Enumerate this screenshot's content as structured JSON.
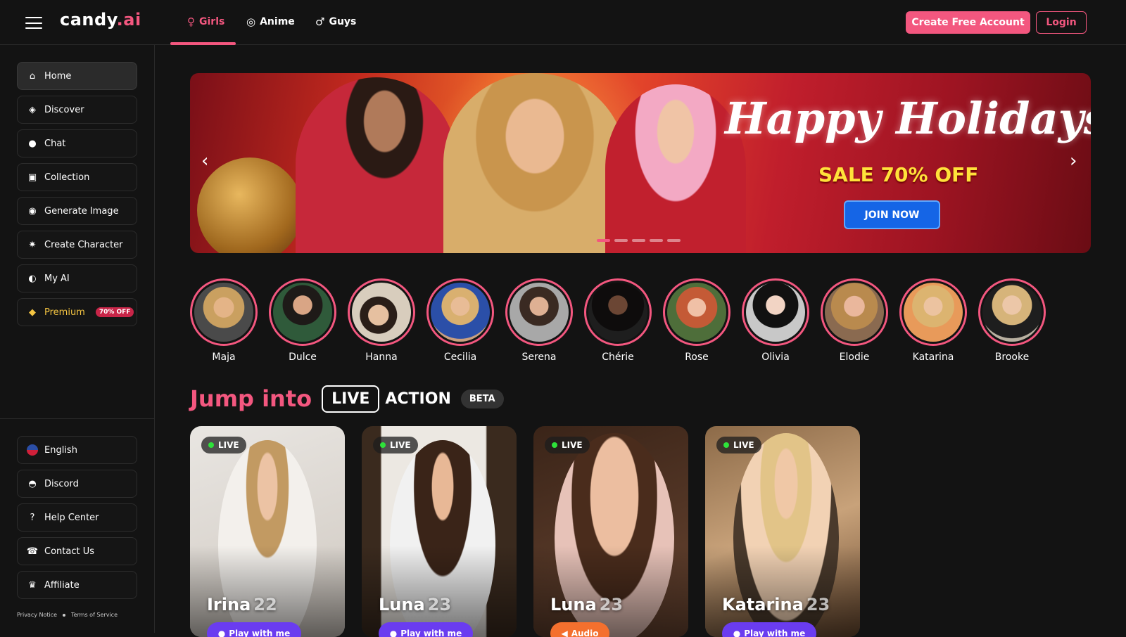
{
  "header": {
    "logo_main": "candy",
    "logo_accent": ".ai",
    "tabs": [
      {
        "label": "Girls",
        "icon": "female-icon"
      },
      {
        "label": "Anime",
        "icon": "anime-icon"
      },
      {
        "label": "Guys",
        "icon": "male-icon"
      }
    ],
    "create_account_label": "Create Free Account",
    "login_label": "Login"
  },
  "sidebar": {
    "items": [
      {
        "label": "Home",
        "icon": "home-icon"
      },
      {
        "label": "Discover",
        "icon": "compass-icon"
      },
      {
        "label": "Chat",
        "icon": "chat-icon"
      },
      {
        "label": "Collection",
        "icon": "image-icon"
      },
      {
        "label": "Generate Image",
        "icon": "camera-icon"
      },
      {
        "label": "Create Character",
        "icon": "magic-wand-icon"
      },
      {
        "label": "My AI",
        "icon": "mask-icon"
      },
      {
        "label": "Premium",
        "icon": "diamond-icon",
        "badge": "70% OFF"
      }
    ],
    "bottom_items": [
      {
        "label": "English",
        "icon": "us-flag-icon"
      },
      {
        "label": "Discord",
        "icon": "discord-icon"
      },
      {
        "label": "Help Center",
        "icon": "help-icon"
      },
      {
        "label": "Contact Us",
        "icon": "phone-icon"
      },
      {
        "label": "Affiliate",
        "icon": "trophy-icon"
      }
    ],
    "legal": {
      "privacy": "Privacy Notice",
      "terms": "Terms of Service"
    }
  },
  "banner": {
    "title": "Happy Holidays",
    "sale": "SALE 70% OFF",
    "cta": "JOIN NOW",
    "slide_count": 5,
    "active_slide": 1
  },
  "stories": [
    "Maja",
    "Dulce",
    "Hanna",
    "Cecilia",
    "Serena",
    "Chérie",
    "Rose",
    "Olivia",
    "Elodie",
    "Katarina",
    "Brooke"
  ],
  "jump": {
    "prefix": "Jump into",
    "live": "LIVE",
    "action": "ACTION",
    "beta": "BETA"
  },
  "cards": [
    {
      "name": "Irina",
      "age": "22",
      "badge": "LIVE",
      "button": "Play with me",
      "button_type": "play"
    },
    {
      "name": "Luna",
      "age": "23",
      "badge": "LIVE",
      "button": "Play with me",
      "button_type": "play"
    },
    {
      "name": "Luna",
      "age": "23",
      "badge": "LIVE",
      "button": "Audio",
      "button_type": "audio"
    },
    {
      "name": "Katarina",
      "age": "23",
      "badge": "LIVE",
      "button": "Play with me",
      "button_type": "play"
    }
  ],
  "colors": {
    "accent": "#f3577f",
    "background": "#131313",
    "premium": "#f5c542",
    "live_dot": "#2ee23a",
    "play_button": "#6a3cf0",
    "audio_button": "#f4702e"
  }
}
